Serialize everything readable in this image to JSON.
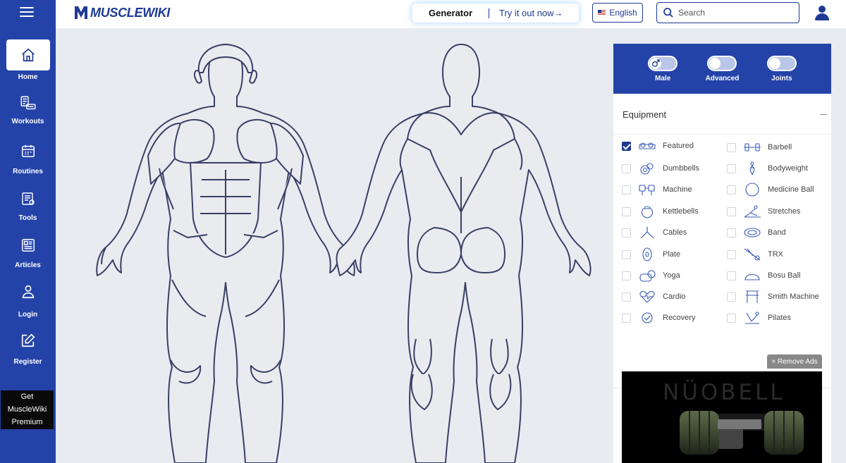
{
  "app": {
    "logo_text": "MUSCLEWIKI"
  },
  "header": {
    "generator_label": "Generator",
    "try_label": "Try it out now→",
    "language": "English",
    "search_placeholder": "Search"
  },
  "sidebar": {
    "items": [
      {
        "label": "Home",
        "icon": "home-icon"
      },
      {
        "label": "Workouts",
        "icon": "workouts-icon"
      },
      {
        "label": "Routines",
        "icon": "calendar-icon"
      },
      {
        "label": "Tools",
        "icon": "tools-icon"
      },
      {
        "label": "Articles",
        "icon": "articles-icon"
      },
      {
        "label": "Login",
        "icon": "user-icon"
      },
      {
        "label": "Register",
        "icon": "edit-icon"
      }
    ],
    "premium_lines": [
      "Get",
      "MuscleWiki",
      "Premium"
    ]
  },
  "toggles": [
    {
      "label": "Male",
      "on": false
    },
    {
      "label": "Advanced",
      "on": false
    },
    {
      "label": "Joints",
      "on": false
    }
  ],
  "equipment": {
    "title": "Equipment",
    "items": [
      {
        "label": "Featured",
        "checked": true,
        "icon": "featured-icon"
      },
      {
        "label": "Barbell",
        "checked": false,
        "icon": "barbell-icon"
      },
      {
        "label": "Dumbbells",
        "checked": false,
        "icon": "dumbbells-icon"
      },
      {
        "label": "Bodyweight",
        "checked": false,
        "icon": "bodyweight-icon"
      },
      {
        "label": "Machine",
        "checked": false,
        "icon": "machine-icon"
      },
      {
        "label": "Medicine Ball",
        "checked": false,
        "icon": "medicine-ball-icon"
      },
      {
        "label": "Kettlebells",
        "checked": false,
        "icon": "kettlebell-icon"
      },
      {
        "label": "Stretches",
        "checked": false,
        "icon": "stretches-icon"
      },
      {
        "label": "Cables",
        "checked": false,
        "icon": "cables-icon"
      },
      {
        "label": "Band",
        "checked": false,
        "icon": "band-icon"
      },
      {
        "label": "Plate",
        "checked": false,
        "icon": "plate-icon"
      },
      {
        "label": "TRX",
        "checked": false,
        "icon": "trx-icon"
      },
      {
        "label": "Yoga",
        "checked": false,
        "icon": "yoga-icon"
      },
      {
        "label": "Bosu Ball",
        "checked": false,
        "icon": "bosu-ball-icon"
      },
      {
        "label": "Cardio",
        "checked": false,
        "icon": "cardio-icon"
      },
      {
        "label": "Smith Machine",
        "checked": false,
        "icon": "smith-machine-icon"
      },
      {
        "label": "Recovery",
        "checked": false,
        "icon": "recovery-icon"
      },
      {
        "label": "Pilates",
        "checked": false,
        "icon": "pilates-icon"
      }
    ]
  },
  "ads": {
    "remove_label": "× Remove Ads",
    "brand": "NÜOBELL"
  },
  "colors": {
    "brand": "#2443a8",
    "accent": "#1f3a93"
  }
}
